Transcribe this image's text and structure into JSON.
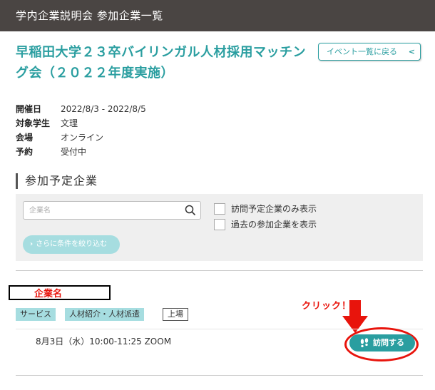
{
  "header": {
    "title": "学内企業説明会 参加企業一覧"
  },
  "event": {
    "title": "早稲田大学２３卒バイリンガル人材採用マッチング会（２０２２年度実施）"
  },
  "back_button": {
    "label": "イベント一覧に戻る",
    "icon": "chevron-left-icon"
  },
  "info": [
    {
      "key": "開催日",
      "value": "2022/8/3 - 2022/8/5"
    },
    {
      "key": "対象学生",
      "value": "文理"
    },
    {
      "key": "会場",
      "value": "オンライン"
    },
    {
      "key": "予約",
      "value": "受付中"
    }
  ],
  "section": {
    "title": "参加予定企業"
  },
  "filter": {
    "search_placeholder": "企業名",
    "search_value": "",
    "checkbox_visit_only": "訪問予定企業のみ表示",
    "checkbox_past": "過去の参加企業を表示",
    "narrow_button": "さらに条件を絞り込む"
  },
  "company": {
    "name": "企業名",
    "tags": [
      "サービス",
      "人材紹介・人材派遣"
    ],
    "listing": "上場",
    "schedule": "8月3日（水）10:00-11:25 ZOOM",
    "visit_button": "訪問する"
  },
  "annotations": {
    "click_label": "クリック！"
  },
  "colors": {
    "accent": "#2a9ea0",
    "tag_bg": "#a6dde0",
    "topbar": "#4a4543",
    "annotation_red": "#e8140c"
  }
}
